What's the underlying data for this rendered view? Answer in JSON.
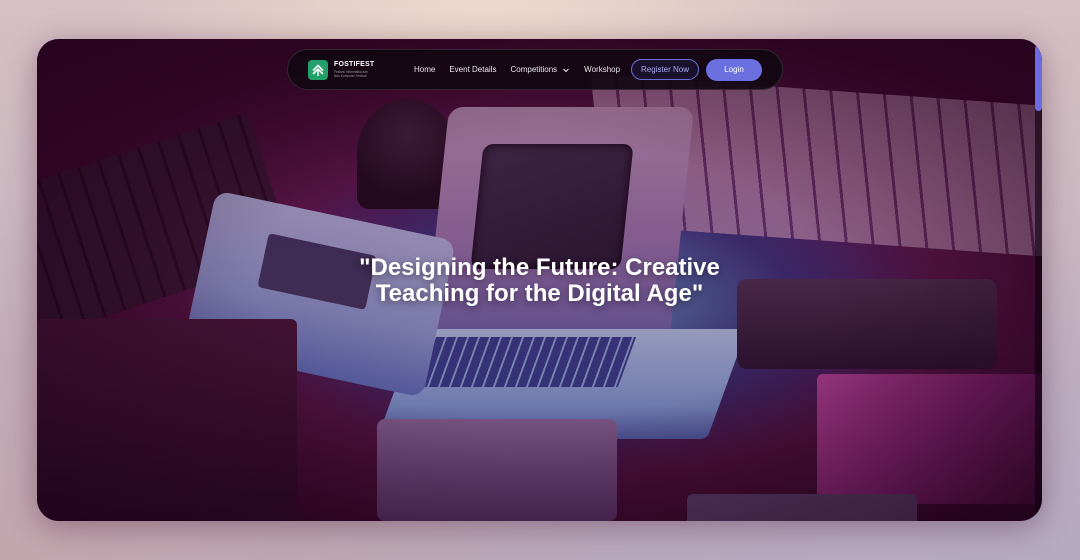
{
  "brand": {
    "name": "FOSTIFEST",
    "tagline": "Festival Informatika dan Ilmu Komputer Festival",
    "logo_color": "#23a06a"
  },
  "nav": {
    "items": [
      {
        "label": "Home"
      },
      {
        "label": "Event Details"
      },
      {
        "label": "Competitions",
        "has_dropdown": true
      },
      {
        "label": "Workshop"
      }
    ],
    "register_label": "Register Now",
    "login_label": "Login"
  },
  "hero": {
    "title": "\"Designing the Future: Creative Teaching for the Digital Age\""
  },
  "colors": {
    "accent": "#6b6fe0",
    "hero_overlay": "#3c0b2c"
  },
  "icons": {
    "logo": "fostifest-logo-icon",
    "dropdown": "chevron-down-icon"
  }
}
